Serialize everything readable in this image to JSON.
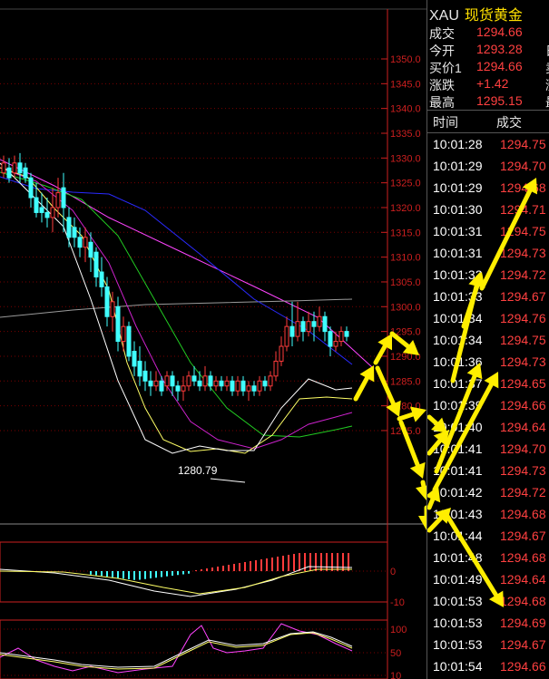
{
  "header": {
    "symbol": "XAU",
    "name": "现货黄金"
  },
  "quote": [
    {
      "label": "成交",
      "value": "1294.66",
      "extra": ""
    },
    {
      "label": "今开",
      "value": "1293.28",
      "extra": "日"
    },
    {
      "label": "买价1",
      "value": "1294.66",
      "extra": "卖"
    },
    {
      "label": "涨跌",
      "value": "+1.42",
      "extra": "涨"
    },
    {
      "label": "最高",
      "value": "1295.15",
      "extra": "最"
    }
  ],
  "ticks_header": {
    "time": "时间",
    "price": "成交"
  },
  "ticks": [
    {
      "time": "10:01:28",
      "price": "1294.75"
    },
    {
      "time": "10:01:29",
      "price": "1294.70"
    },
    {
      "time": "10:01:29",
      "price": "1294.68"
    },
    {
      "time": "10:01:30",
      "price": "1294.71"
    },
    {
      "time": "10:01:31",
      "price": "1294.75"
    },
    {
      "time": "10:01:31",
      "price": "1294.73"
    },
    {
      "time": "10:01:32",
      "price": "1294.72"
    },
    {
      "time": "10:01:33",
      "price": "1294.67"
    },
    {
      "time": "10:01:34",
      "price": "1294.76"
    },
    {
      "time": "10:01:34",
      "price": "1294.75"
    },
    {
      "time": "10:01:36",
      "price": "1294.73"
    },
    {
      "time": "10:01:37",
      "price": "1294.65"
    },
    {
      "time": "10:01:39",
      "price": "1294.66"
    },
    {
      "time": "10:01:40",
      "price": "1294.64"
    },
    {
      "time": "10:01:41",
      "price": "1294.70"
    },
    {
      "time": "10:01:41",
      "price": "1294.73"
    },
    {
      "time": "10:01:42",
      "price": "1294.72"
    },
    {
      "time": "10:01:43",
      "price": "1294.68"
    },
    {
      "time": "10:01:44",
      "price": "1294.67"
    },
    {
      "time": "10:01:48",
      "price": "1294.68"
    },
    {
      "time": "10:01:49",
      "price": "1294.64"
    },
    {
      "time": "10:01:53",
      "price": "1294.68"
    },
    {
      "time": "10:01:53",
      "price": "1294.69"
    },
    {
      "time": "10:01:53",
      "price": "1294.67"
    },
    {
      "time": "10:01:54",
      "price": "1294.66"
    }
  ],
  "chart": {
    "price_ticks": [
      "1350.0",
      "1345.0",
      "1340.0",
      "1335.0",
      "1330.0",
      "1325.0",
      "1320.0",
      "1315.0",
      "1310.0",
      "1305.0",
      "1300.0",
      "1295.0",
      "1290.0",
      "1285.0",
      "1280.0",
      "1275.0"
    ],
    "low_label": "1280.79",
    "macd_ticks": [
      "0",
      "-10"
    ],
    "kdj_ticks": [
      "100",
      "50",
      "10"
    ]
  },
  "colors": {
    "price_up": "#ff4040",
    "candle_down": "#40ffff",
    "annotation": "#ffee00",
    "grid": "#8b0000"
  }
}
